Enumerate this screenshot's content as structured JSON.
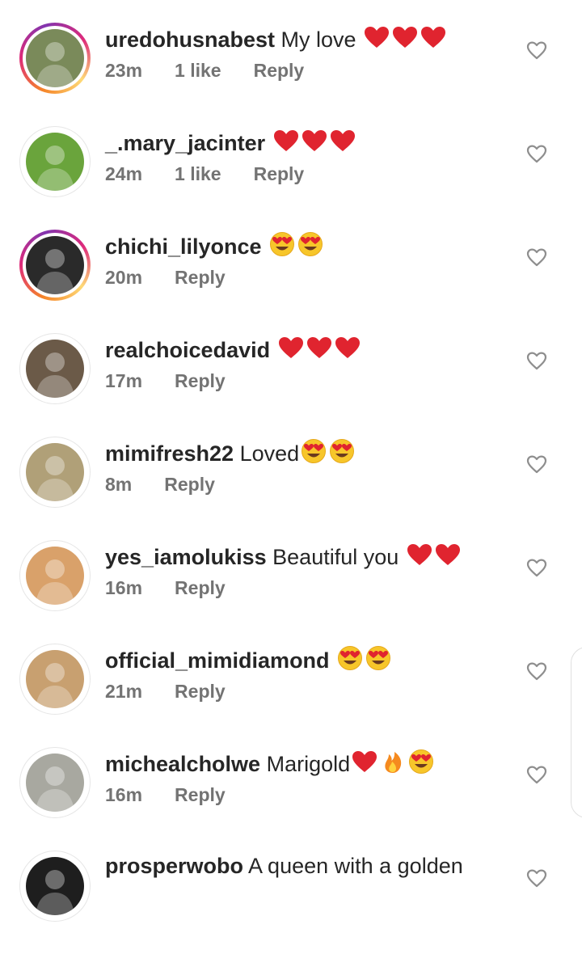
{
  "comments": [
    {
      "username": "uredohusnabest",
      "text": "My love",
      "emojis": [
        "heart",
        "heart",
        "heart"
      ],
      "time": "23m",
      "likes": "1 like",
      "reply": "Reply",
      "story": true,
      "avatar_color": "#7a8a5a"
    },
    {
      "username": "_.mary_jacinter",
      "text": "",
      "emojis": [
        "heart",
        "heart",
        "heart"
      ],
      "time": "24m",
      "likes": "1 like",
      "reply": "Reply",
      "story": false,
      "avatar_color": "#6aa43c"
    },
    {
      "username": "chichi_lilyonce",
      "text": "",
      "emojis": [
        "heart-eyes",
        "heart-eyes"
      ],
      "time": "20m",
      "likes": "",
      "reply": "Reply",
      "story": true,
      "avatar_color": "#2a2a2a"
    },
    {
      "username": "realchoicedavid",
      "text": "",
      "emojis": [
        "heart",
        "heart",
        "heart"
      ],
      "time": "17m",
      "likes": "",
      "reply": "Reply",
      "story": false,
      "avatar_color": "#6b5a48"
    },
    {
      "username": "mimifresh22",
      "text": "Loved",
      "emojis": [
        "heart-eyes",
        "heart-eyes"
      ],
      "time": "8m",
      "likes": "",
      "reply": "Reply",
      "story": false,
      "avatar_color": "#b0a078"
    },
    {
      "username": "yes_iamolukiss",
      "text": "Beautiful you",
      "emojis": [
        "heart",
        "heart"
      ],
      "time": "16m",
      "likes": "",
      "reply": "Reply",
      "story": false,
      "avatar_color": "#d9a16a"
    },
    {
      "username": "official_mimidiamond",
      "text": "",
      "emojis": [
        "heart-eyes",
        "heart-eyes"
      ],
      "time": "21m",
      "likes": "",
      "reply": "Reply",
      "story": false,
      "avatar_color": "#c8a070"
    },
    {
      "username": "michealcholwe",
      "text": "Marigold",
      "emojis": [
        "heart",
        "fire",
        "heart-eyes"
      ],
      "time": "16m",
      "likes": "",
      "reply": "Reply",
      "story": false,
      "avatar_color": "#a8a8a0"
    },
    {
      "username": "prosperwobo",
      "text": "A queen with a golden",
      "emojis": [],
      "time": "",
      "likes": "",
      "reply": "",
      "story": false,
      "avatar_color": "#1e1e1e"
    }
  ],
  "icons": {
    "like": "heart-outline-icon"
  },
  "colors": {
    "heart": "#e0242f",
    "meta": "#737373",
    "text": "#262626"
  }
}
